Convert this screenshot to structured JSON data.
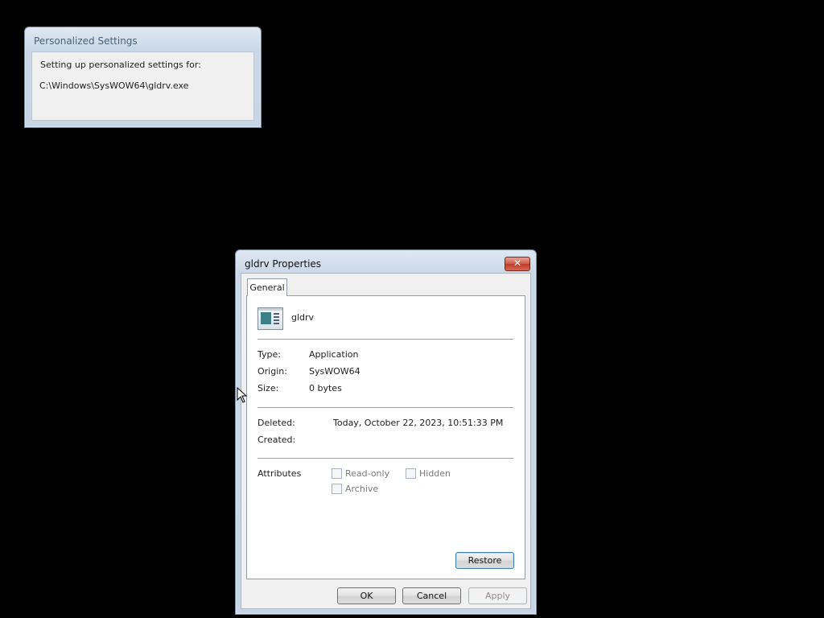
{
  "personalized": {
    "title": "Personalized Settings",
    "message": "Setting up personalized settings for:",
    "path": "C:\\Windows\\SysWOW64\\gldrv.exe"
  },
  "properties": {
    "title": "gldrv Properties",
    "close_icon": "close-icon",
    "tab": "General",
    "file_icon": "application-icon",
    "file_name": "gldrv",
    "type_label": "Type:",
    "type_value": "Application",
    "origin_label": "Origin:",
    "origin_value": "SysWOW64",
    "size_label": "Size:",
    "size_value": "0 bytes",
    "deleted_label": "Deleted:",
    "deleted_value": "Today, October 22, 2023, 10:51:33 PM",
    "created_label": "Created:",
    "attributes_label": "Attributes",
    "readonly": "Read-only",
    "hidden": "Hidden",
    "archive": "Archive",
    "restore": "Restore",
    "ok": "OK",
    "cancel": "Cancel",
    "apply": "Apply"
  }
}
